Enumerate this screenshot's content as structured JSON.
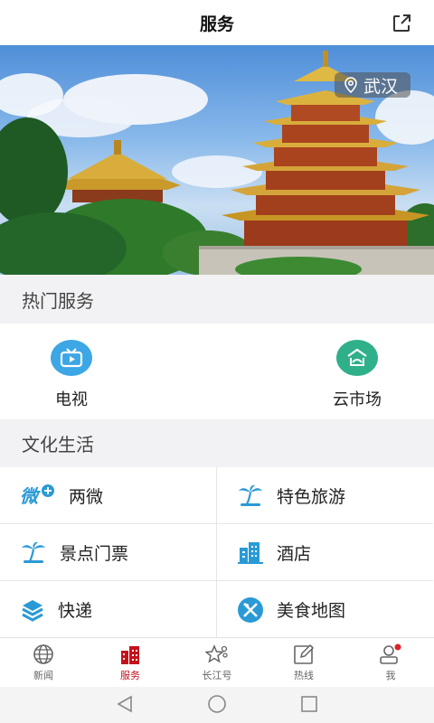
{
  "header": {
    "title": "服务"
  },
  "banner": {
    "location": "武汉"
  },
  "hot_services": {
    "title": "热门服务",
    "items": [
      {
        "label": "电视",
        "icon": "tv-play-icon",
        "color": "#3da6e5"
      },
      {
        "label": "云市场",
        "icon": "cloud-market-icon",
        "color": "#2fb08a"
      }
    ]
  },
  "culture": {
    "title": "文化生活",
    "items": [
      {
        "label": "两微",
        "icon": "weibo-weixin-icon"
      },
      {
        "label": "特色旅游",
        "icon": "palm-tree-icon"
      },
      {
        "label": "景点门票",
        "icon": "palm-tree-icon"
      },
      {
        "label": "酒店",
        "icon": "building-icon"
      },
      {
        "label": "快递",
        "icon": "package-icon"
      },
      {
        "label": "美食地图",
        "icon": "fork-knife-icon"
      }
    ],
    "icon_color": "#2a9ad6"
  },
  "tabbar": {
    "active": "服务",
    "accent": "#c4111b",
    "items": [
      {
        "label": "新闻",
        "icon": "globe-icon"
      },
      {
        "label": "服务",
        "icon": "city-icon"
      },
      {
        "label": "长江号",
        "icon": "star-icon"
      },
      {
        "label": "热线",
        "icon": "edit-icon"
      },
      {
        "label": "我",
        "icon": "user-icon"
      }
    ]
  }
}
